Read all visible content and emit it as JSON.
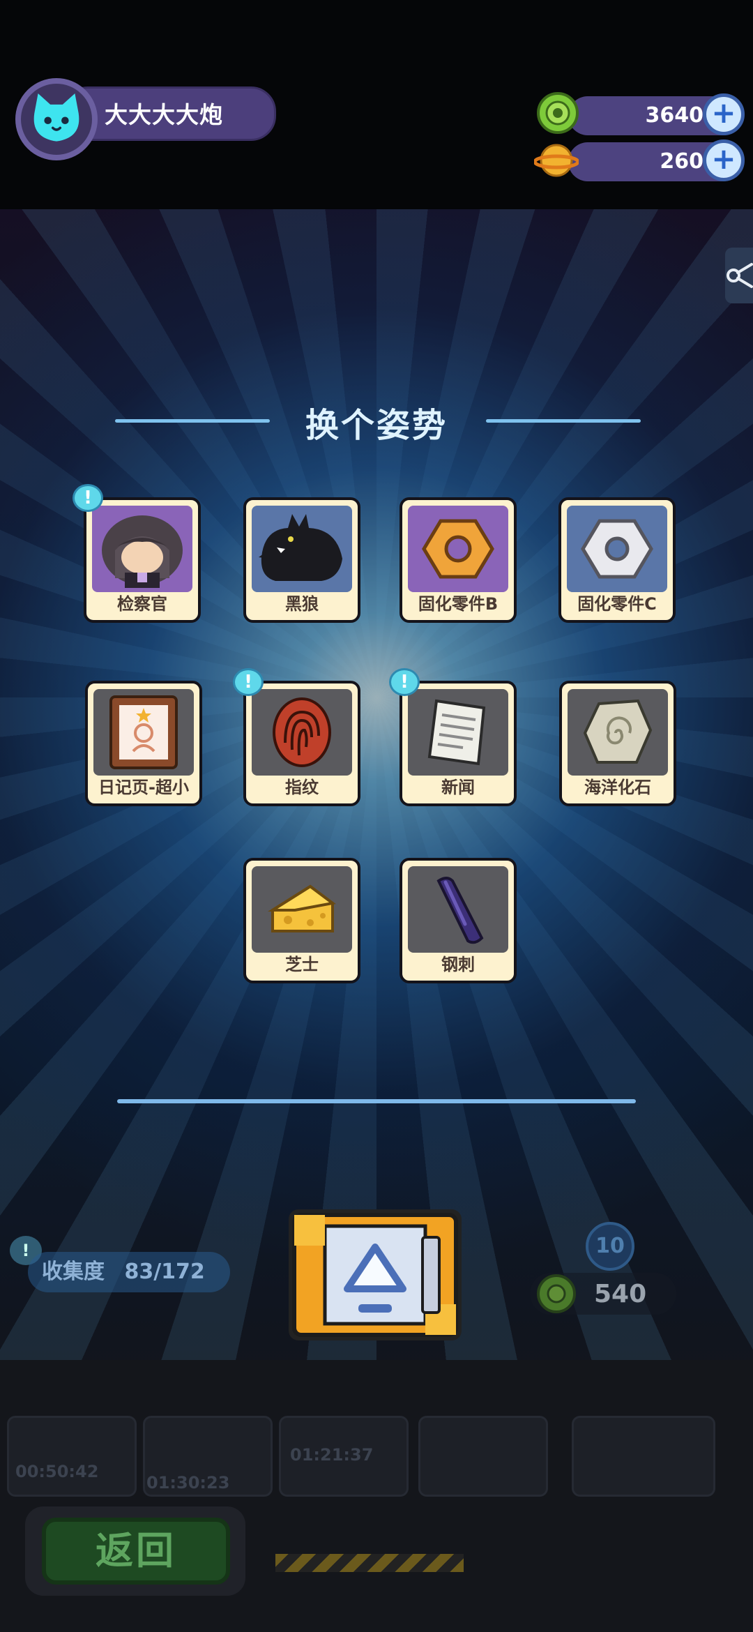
{
  "player": {
    "name": "大大大大炮"
  },
  "currencies": [
    {
      "name": "green-gear-coin",
      "value": "3640",
      "color": "#7ecb3a"
    },
    {
      "name": "planet-coin",
      "value": "260",
      "color": "#f2b230"
    }
  ],
  "dialog": {
    "title": "换个姿势",
    "items": [
      {
        "label": "检察官",
        "icon": "prosecutor-icon",
        "new": true
      },
      {
        "label": "黑狼",
        "icon": "black-wolf-icon",
        "new": false
      },
      {
        "label": "固化零件B",
        "icon": "hex-nut-orange-icon",
        "new": false
      },
      {
        "label": "固化零件C",
        "icon": "hex-nut-white-icon",
        "new": false
      },
      {
        "label": "日记页-超小",
        "icon": "diary-page-icon",
        "new": false
      },
      {
        "label": "指纹",
        "icon": "fingerprint-icon",
        "new": true
      },
      {
        "label": "新闻",
        "icon": "newspaper-icon",
        "new": true
      },
      {
        "label": "海洋化石",
        "icon": "ocean-fossil-icon",
        "new": false
      },
      {
        "label": "芝士",
        "icon": "cheese-icon",
        "new": false
      },
      {
        "label": "钢刺",
        "icon": "steel-spike-icon",
        "new": false
      }
    ]
  },
  "collection": {
    "label": "收集度",
    "value": "83/172"
  },
  "machine": {
    "level": "10",
    "cost": "540"
  },
  "timers": [
    "00:50:42",
    "01:30:23",
    "01:21:37"
  ],
  "back_button": "返回",
  "badge_symbol": "!"
}
